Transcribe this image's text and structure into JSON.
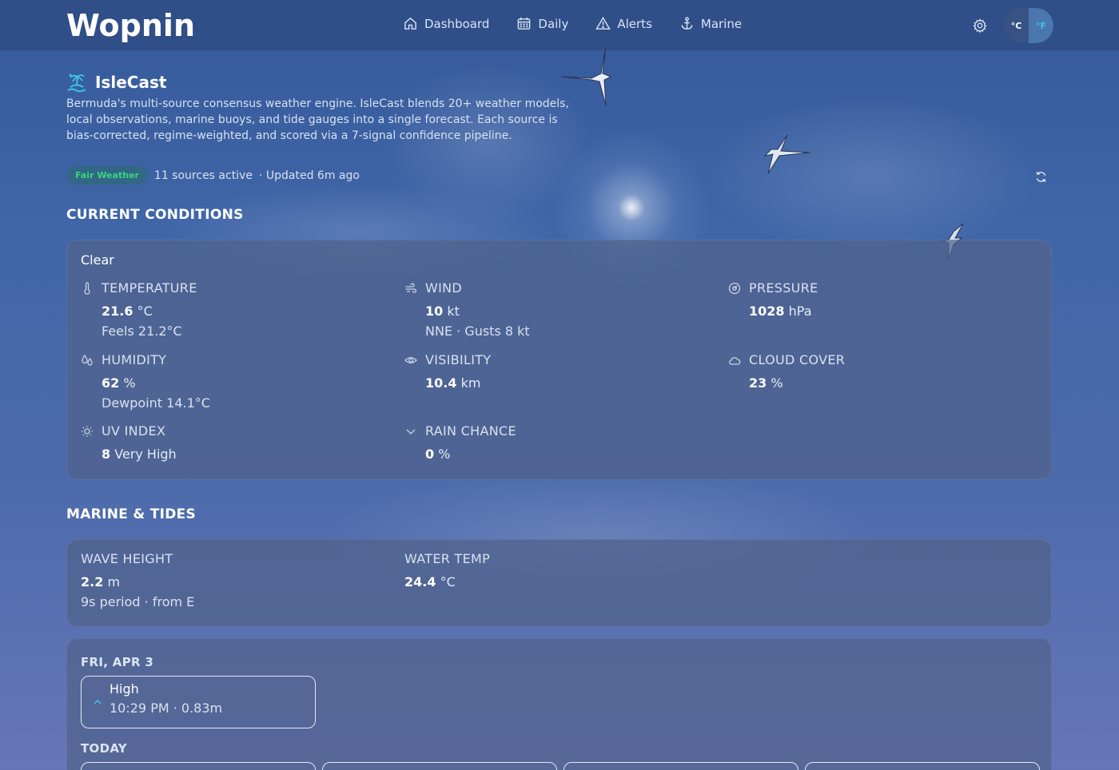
{
  "nav": {
    "logo": "Wopnin",
    "items": [
      {
        "label": "Dashboard",
        "icon": "home-icon"
      },
      {
        "label": "Daily",
        "icon": "calendar-icon"
      },
      {
        "label": "Alerts",
        "icon": "warning-icon"
      },
      {
        "label": "Marine",
        "icon": "anchor-icon"
      }
    ],
    "settings_icon": "gear-icon",
    "units": {
      "celsius": "°C",
      "fahrenheit": "°F",
      "active": "fahrenheit"
    }
  },
  "header": {
    "brand_icon": "isle-icon",
    "brand_name": "IsleCast",
    "description": "Bermuda's multi-source consensus weather engine. IsleCast blends 20+ weather models, local observations, marine buoys, and tide gauges into a single forecast. Each source is bias-corrected, regime-weighted, and scored via a 7-signal confidence pipeline.",
    "badge": "Fair Weather",
    "sources": "11 sources active",
    "updated": "· Updated 6m ago",
    "refresh_icon": "refresh-icon"
  },
  "current": {
    "section_title": "CURRENT CONDITIONS",
    "condition": "Clear",
    "temperature": {
      "label": "TEMPERATURE",
      "value": "21.6",
      "unit": "°C",
      "sub": "Feels 21.2°C",
      "icon": "thermometer-icon"
    },
    "wind": {
      "label": "WIND",
      "value": "10",
      "unit": "kt",
      "sub": "NNE · Gusts 8 kt",
      "icon": "wind-icon"
    },
    "pressure": {
      "label": "PRESSURE",
      "value": "1028",
      "unit": "hPa",
      "icon": "gauge-icon"
    },
    "humidity": {
      "label": "HUMIDITY",
      "value": "62",
      "unit": "%",
      "sub": "Dewpoint 14.1°C",
      "icon": "droplets-icon"
    },
    "visibility": {
      "label": "VISIBILITY",
      "value": "10.4",
      "unit": "km",
      "icon": "eye-icon"
    },
    "cloud_cover": {
      "label": "CLOUD COVER",
      "value": "23",
      "unit": "%",
      "icon": "cloud-icon"
    },
    "uv_index": {
      "label": "UV INDEX",
      "value": "8",
      "unit": "Very High",
      "icon": "sun-icon"
    },
    "rain_chance": {
      "label": "RAIN CHANCE",
      "value": "0",
      "unit": "%",
      "icon": "chevron-down-icon"
    }
  },
  "marine": {
    "section_title": "MARINE & TIDES",
    "wave_height": {
      "label": "WAVE HEIGHT",
      "value": "2.2",
      "unit": "m",
      "sub": "9s period · from E"
    },
    "water_temp": {
      "label": "WATER TEMP",
      "value": "24.4",
      "unit": "°C"
    }
  },
  "tides": {
    "date": "FRI, APR 3",
    "entry": {
      "type": "High",
      "detail": "10:29 PM · 0.83m"
    },
    "today_label": "TODAY"
  },
  "colors": {
    "accent": "#3ec3e6",
    "badge_text": "#39d27f",
    "background": "#4066a8"
  }
}
